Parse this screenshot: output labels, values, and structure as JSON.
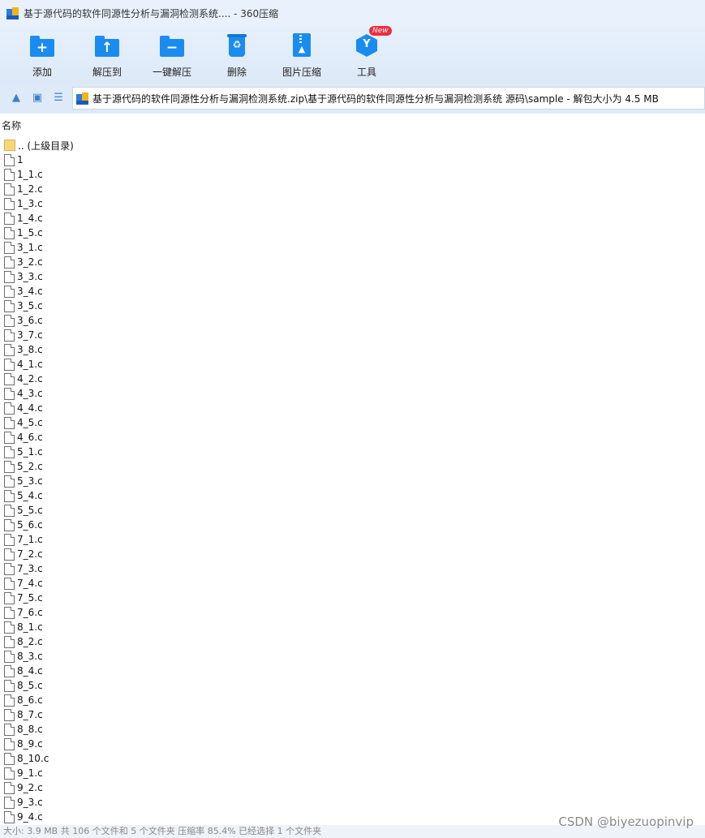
{
  "window": {
    "title": "基于源代码的软件同源性分析与漏洞检测系统.... - 360压缩"
  },
  "toolbar": {
    "buttons": [
      {
        "label": "添加",
        "icon": "plus-folder-icon",
        "symbol": "+"
      },
      {
        "label": "解压到",
        "icon": "extract-to-icon",
        "symbol": "↑"
      },
      {
        "label": "一键解压",
        "icon": "one-click-extract-icon",
        "symbol": "−"
      },
      {
        "label": "删除",
        "icon": "recycle-icon",
        "symbol": "♻"
      },
      {
        "label": "图片压缩",
        "icon": "image-compress-icon",
        "symbol": "▲"
      },
      {
        "label": "工具",
        "icon": "tools-icon",
        "symbol": "Y"
      }
    ],
    "new_badge": "New"
  },
  "nav": {
    "path": "基于源代码的软件同源性分析与漏洞检测系统.zip\\基于源代码的软件同源性分析与漏洞检测系统 源码\\sample - 解包大小为 4.5 MB"
  },
  "list": {
    "column_name": "名称",
    "parent_label": ".. (上级目录)",
    "files": [
      "1",
      "1_1.c",
      "1_2.c",
      "1_3.c",
      "1_4.c",
      "1_5.c",
      "3_1.c",
      "3_2.c",
      "3_3.c",
      "3_4.c",
      "3_5.c",
      "3_6.c",
      "3_7.c",
      "3_8.c",
      "4_1.c",
      "4_2.c",
      "4_3.c",
      "4_4.c",
      "4_5.c",
      "4_6.c",
      "5_1.c",
      "5_2.c",
      "5_3.c",
      "5_4.c",
      "5_5.c",
      "5_6.c",
      "7_1.c",
      "7_2.c",
      "7_3.c",
      "7_4.c",
      "7_5.c",
      "7_6.c",
      "8_1.c",
      "8_2.c",
      "8_3.c",
      "8_4.c",
      "8_5.c",
      "8_6.c",
      "8_7.c",
      "8_8.c",
      "8_9.c",
      "8_10.c",
      "9_1.c",
      "9_2.c",
      "9_3.c",
      "9_4.c"
    ]
  },
  "status": {
    "text": "大小: 3.9 MB 共 106 个文件和 5 个文件夹 压缩率 85.4% 已经选择 1 个文件夹"
  },
  "watermark": "CSDN @biyezuopinvip",
  "colors": {
    "accent": "#1a8cf0",
    "badge": "#ef2d3b",
    "folder": "#f7d77a"
  }
}
